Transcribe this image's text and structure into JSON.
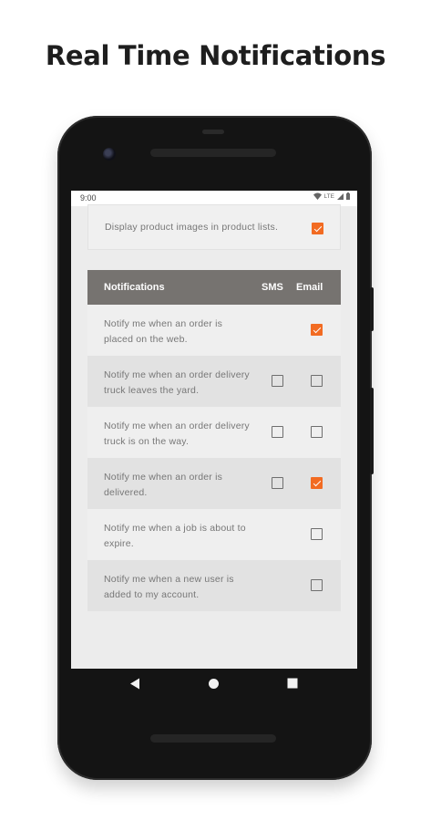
{
  "page_title": "Real Time Notifications",
  "status_bar": {
    "time": "9:00",
    "network": "LTE"
  },
  "display_setting": {
    "label": "Display product images in product lists.",
    "checked": true
  },
  "table": {
    "headers": {
      "notifications": "Notifications",
      "sms": "SMS",
      "email": "Email"
    },
    "rows": [
      {
        "label": "Notify me when an order is placed on the web.",
        "sms": null,
        "email": true
      },
      {
        "label": "Notify me when an order delivery truck leaves the yard.",
        "sms": false,
        "email": false
      },
      {
        "label": "Notify me when an order delivery truck is on the way.",
        "sms": false,
        "email": false
      },
      {
        "label": "Notify me when an order is delivered.",
        "sms": false,
        "email": true
      },
      {
        "label": "Notify me when a job is about to expire.",
        "sms": null,
        "email": false
      },
      {
        "label": "Notify me when a new user is added to my account.",
        "sms": null,
        "email": false
      }
    ]
  },
  "colors": {
    "accent": "#f26b22",
    "header_bg": "#767370",
    "screen_bg": "#ececec"
  },
  "nav": {
    "back": "back-icon",
    "home": "home-icon",
    "recents": "recents-icon"
  }
}
